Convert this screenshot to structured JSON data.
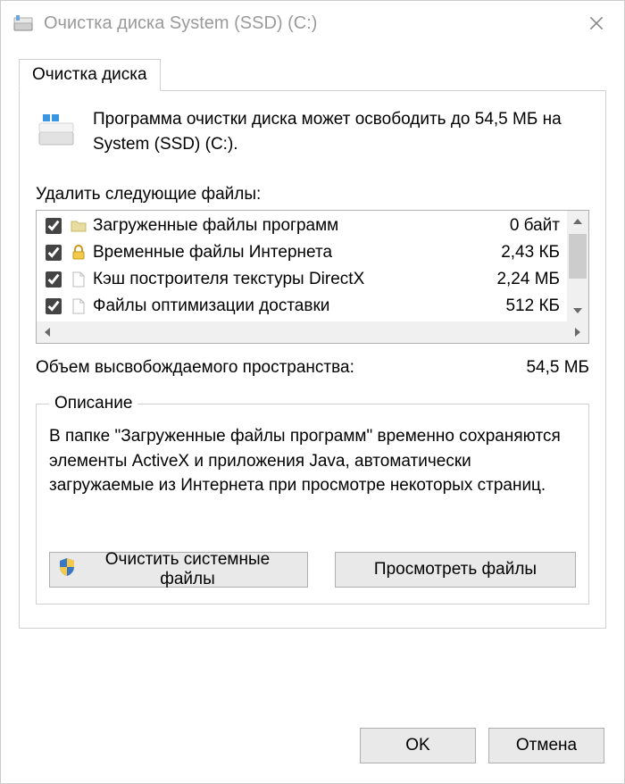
{
  "window": {
    "title": "Очистка диска System (SSD) (C:)"
  },
  "tab": {
    "label": "Очистка диска"
  },
  "intro": {
    "text": "Программа очистки диска может освободить до 54,5 МБ на System (SSD) (C:)."
  },
  "delete_label": "Удалить следующие файлы:",
  "files": [
    {
      "name": "Загруженные файлы программ",
      "size": "0 байт",
      "checked": true
    },
    {
      "name": "Временные файлы Интернета",
      "size": "2,43 КБ",
      "checked": true
    },
    {
      "name": "Кэш построителя текстуры DirectX",
      "size": "2,24 МБ",
      "checked": true
    },
    {
      "name": "Файлы оптимизации доставки",
      "size": "512 КБ",
      "checked": true
    }
  ],
  "freed": {
    "label": "Объем высвобождаемого пространства:",
    "value": "54,5 МБ"
  },
  "description": {
    "legend": "Описание",
    "text": "В папке \"Загруженные файлы программ\" временно сохраняются элементы ActiveX и приложения Java, автоматически загружаемые из Интернета при просмотре некоторых страниц."
  },
  "buttons": {
    "clean_system": "Очистить системные файлы",
    "view_files": "Просмотреть файлы",
    "ok": "OK",
    "cancel": "Отмена"
  }
}
